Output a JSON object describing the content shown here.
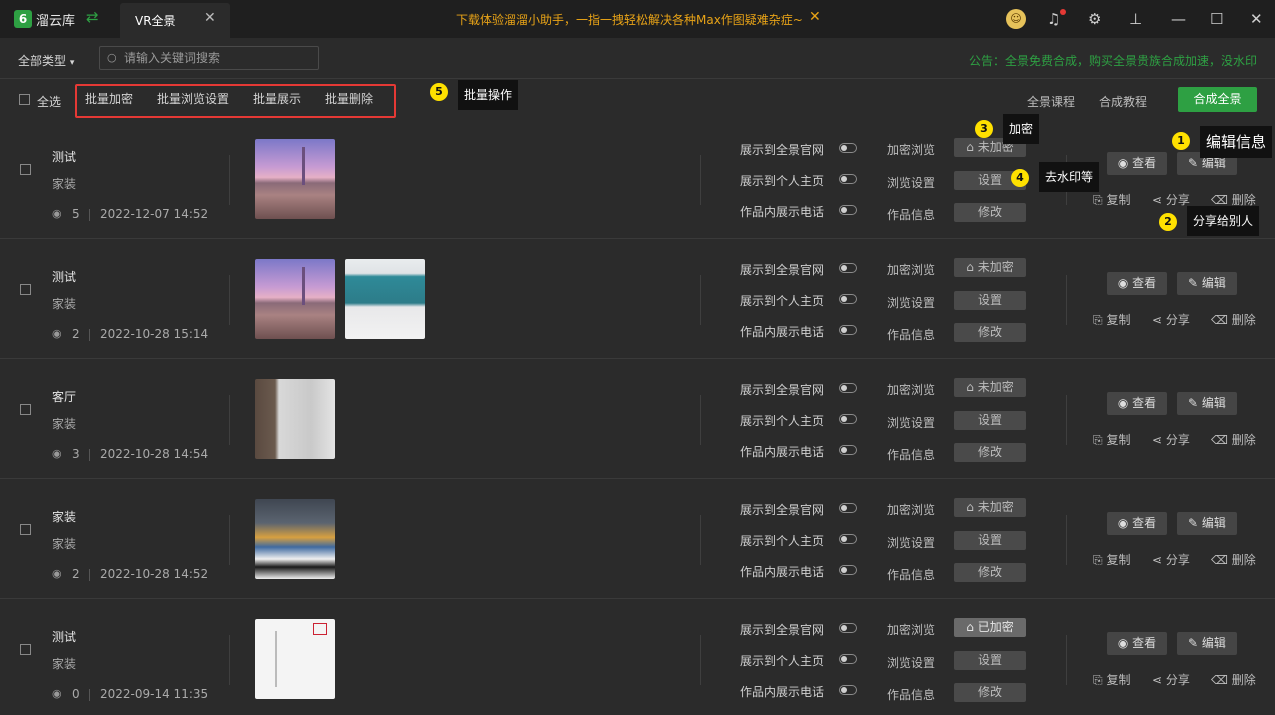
{
  "titlebar": {
    "app_name": "溜云库",
    "logo_text": "6",
    "tab_label": "VR全景",
    "promo": "下载体验溜溜小助手，一指一拽轻松解决各种Max作图疑难杂症~",
    "icons": [
      "swap-icon",
      "close-icon",
      "avatar",
      "bell-icon",
      "gear-icon",
      "pin-icon",
      "minimize-icon",
      "maximize-icon",
      "window-close-icon"
    ]
  },
  "filter": {
    "all_types": "全部类型",
    "search_placeholder": "请输入关键词搜索",
    "notice": "公告：全景免费合成，购买全景贵族合成加速，没水印"
  },
  "actions": {
    "select_all": "全选",
    "batch_encrypt": "批量加密",
    "batch_browse": "批量浏览设置",
    "batch_display": "批量展示",
    "batch_delete": "批量删除",
    "course": "全景课程",
    "tutorial": "合成教程",
    "compose": "合成全景"
  },
  "callouts": {
    "c1": {
      "num": "1",
      "label": "编辑信息"
    },
    "c2": {
      "num": "2",
      "label": "分享给别人"
    },
    "c3": {
      "num": "3",
      "label": "加密"
    },
    "c4": {
      "num": "4",
      "label": "去水印等"
    },
    "c5": {
      "num": "5",
      "label": "批量操作"
    }
  },
  "labels": {
    "show_official": "展示到全景官网",
    "show_personal": "展示到个人主页",
    "show_phone": "作品内展示电话",
    "encrypt_browse": "加密浏览",
    "browse_settings": "浏览设置",
    "work_info": "作品信息",
    "unencrypted": "未加密",
    "encrypted": "已加密",
    "settings": "设置",
    "modify": "修改",
    "view": "查看",
    "edit": "编辑",
    "copy": "复制",
    "share": "分享",
    "delete": "删除"
  },
  "rows": [
    {
      "title": "测试",
      "category": "家装",
      "views": "5",
      "date": "2022-12-07 14:52",
      "encrypted": false
    },
    {
      "title": "测试",
      "category": "家装",
      "views": "2",
      "date": "2022-10-28 15:14",
      "encrypted": false
    },
    {
      "title": "客厅",
      "category": "家装",
      "views": "3",
      "date": "2022-10-28 14:54",
      "encrypted": false
    },
    {
      "title": "家装",
      "category": "家装",
      "views": "2",
      "date": "2022-10-28 14:52",
      "encrypted": false
    },
    {
      "title": "测试",
      "category": "家装",
      "views": "0",
      "date": "2022-09-14 11:35",
      "encrypted": true
    }
  ]
}
